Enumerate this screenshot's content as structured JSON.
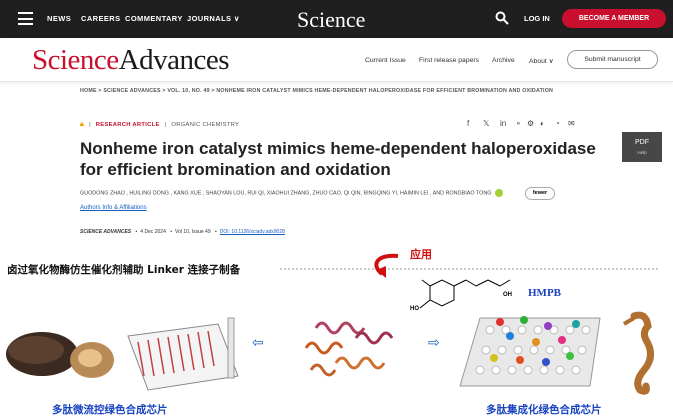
{
  "topbar": {
    "nav": [
      "NEWS",
      "CAREERS",
      "COMMENTARY",
      "JOURNALS ∨"
    ],
    "logo": "Science",
    "login": "LOG IN",
    "member": "BECOME A MEMBER"
  },
  "subnav": {
    "brand_a": "Science",
    "brand_b": "Advances",
    "links": [
      "Current Issue",
      "First release papers",
      "Archive",
      "About ∨"
    ],
    "submit": "Submit manuscript"
  },
  "breadcrumb": "HOME  >  SCIENCE ADVANCES  >  VOL. 10, NO. 49  >  NONHEME IRON CATALYST MIMICS HEME-DEPENDENT HALOPEROXIDASE FOR EFFICIENT BROMINATION AND OXIDATION",
  "article": {
    "type": "RESEARCH ARTICLE",
    "category": "ORGANIC CHEMISTRY",
    "title": "Nonheme iron catalyst mimics heme-dependent haloperoxidase for efficient bromination and oxidation",
    "authors": "GUODONG ZHAO  , HUILING DONG  , KANG XUE  , SHAOYAN LOU, RUI QI, XIAOHUI ZHANG, ZHUO CAO, QI QIN, BINGQING YI, HAIMIN LEI  , AND RONGBIAO TONG",
    "fewer": "fewer",
    "affiliations": "Authors Info & Affiliations",
    "journal": "SCIENCE ADVANCES",
    "date": "4 Dec 2024",
    "volume": "Vol 10, Issue 49",
    "doi": "DOI: 10.1126/sciadv.ads9028"
  },
  "pdf": {
    "label": "PDF",
    "sub": "Help"
  },
  "overlay": {
    "left_text": "卤过氧化物酶仿生催化剂辅助 Linker 连接子制备",
    "apply": "应用",
    "hmpb": "HMPB",
    "caption_left": "多肽微流控绿色合成芯片",
    "caption_right": "多肽集成化绿色合成芯片",
    "chem_oh": "OH",
    "chem_ho": "HO"
  },
  "colors": {
    "brand": "#c8102e",
    "link": "#1a5bbf",
    "orcid": "#a6ce39"
  }
}
